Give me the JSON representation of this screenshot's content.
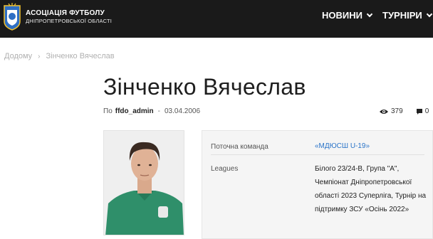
{
  "header": {
    "brand_line1": "АСОЦІАЦІЯ ФУТБОЛУ",
    "brand_line2": "ДНІПРОПЕТРОВСЬКОЇ ОБЛАСТІ",
    "nav": [
      {
        "label": "НОВИНИ"
      },
      {
        "label": "ТУРНІРИ"
      }
    ]
  },
  "breadcrumb": {
    "home": "Додому",
    "separator": "›",
    "current": "Зінченко Вячеслав"
  },
  "page": {
    "title": "Зінченко Вячеслав",
    "by_label": "По",
    "author": "ffdo_admin",
    "dash": "-",
    "date": "03.04.2006",
    "views": "379",
    "comments": "0"
  },
  "info": {
    "rows": [
      {
        "label": "Поточна команда",
        "value": "«МДЮСШ U-19»"
      },
      {
        "label": "Leagues",
        "value": "Білого 23/24-В, Група \"А\", Чемпіонат Дніпропетровської області 2023 Суперліга, Турнір на підтримку ЗСУ «Осінь 2022»"
      }
    ]
  },
  "colors": {
    "header_bg": "#1a1a1a",
    "link": "#2a74c8",
    "info_bg": "#f5f5f5"
  },
  "icons": {
    "logo": "coat-of-arms-icon",
    "views": "eye-icon",
    "comments": "comment-icon",
    "nav_chevron": "chevron-down-icon"
  }
}
